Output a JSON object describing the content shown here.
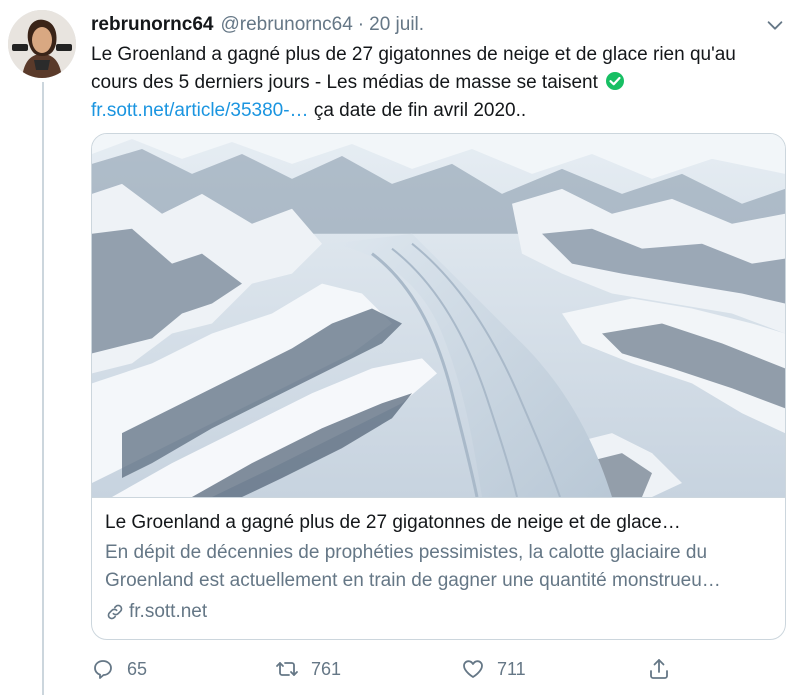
{
  "tweet": {
    "display_name": "rebrunornc64",
    "handle": "@rebrunornc64",
    "separator": "·",
    "date": "20 juil.",
    "text_part1": "Le Groenland a gagné plus de 27 gigatonnes de neige et de glace rien qu'au cours des 5 derniers jours - Les médias de masse se taisent",
    "link_text": "fr.sott.net/article/35380-…",
    "text_part2": " ça date de fin avril 2020.."
  },
  "card": {
    "image_alt": "Aerial view of Greenland glaciers",
    "title": "Le Groenland a gagné plus de 27 gigatonnes de neige et de glace…",
    "description": "En dépit de décennies de prophéties pessimistes, la calotte glaciaire du Groenland est actuellement en train de gagner une quantité monstrueu…",
    "domain": "fr.sott.net"
  },
  "actions": {
    "replies": "65",
    "retweets": "761",
    "likes": "711"
  },
  "icons": {
    "reply": "reply-icon",
    "retweet": "retweet-icon",
    "like": "heart-icon",
    "share": "share-icon",
    "verified": "check-circle-icon",
    "link": "link-icon",
    "more": "chevron-down-icon"
  },
  "colors": {
    "link": "#1b95e0",
    "muted": "#657786",
    "text": "#14171a",
    "border": "#ccd6dd",
    "verified": "#17bf63"
  }
}
